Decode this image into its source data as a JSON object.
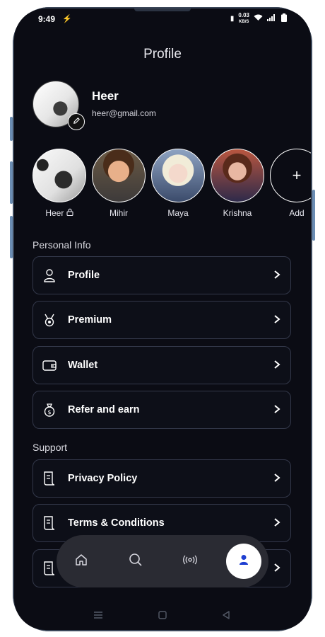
{
  "status_bar": {
    "time": "9:49",
    "speed_value": "0.03",
    "speed_unit": "KB/S"
  },
  "header": {
    "title": "Profile"
  },
  "user": {
    "name": "Heer",
    "email": "heer@gmail.com"
  },
  "members": [
    {
      "name": "Heer",
      "locked": true
    },
    {
      "name": "Mihir"
    },
    {
      "name": "Maya"
    },
    {
      "name": "Krishna"
    },
    {
      "name": "Add"
    }
  ],
  "personal_info": {
    "label": "Personal Info",
    "items": [
      {
        "label": "Profile",
        "icon": "user-icon"
      },
      {
        "label": "Premium",
        "icon": "medal-icon"
      },
      {
        "label": "Wallet",
        "icon": "wallet-icon"
      },
      {
        "label": "Refer and earn",
        "icon": "money-bag-icon"
      }
    ]
  },
  "support": {
    "label": "Support",
    "items": [
      {
        "label": "Privacy Policy",
        "icon": "document-icon"
      },
      {
        "label": "Terms & Conditions",
        "icon": "document-icon"
      },
      {
        "label": "",
        "icon": "document-icon"
      }
    ]
  },
  "bottom_nav": {
    "items": [
      "home-icon",
      "search-icon",
      "broadcast-icon",
      "profile-icon"
    ],
    "active": "profile-icon",
    "active_color": "#1f3fd1"
  },
  "colors": {
    "background": "#0b0c14",
    "card_border": "#33384a",
    "nav_bg": "#2a2b33"
  }
}
